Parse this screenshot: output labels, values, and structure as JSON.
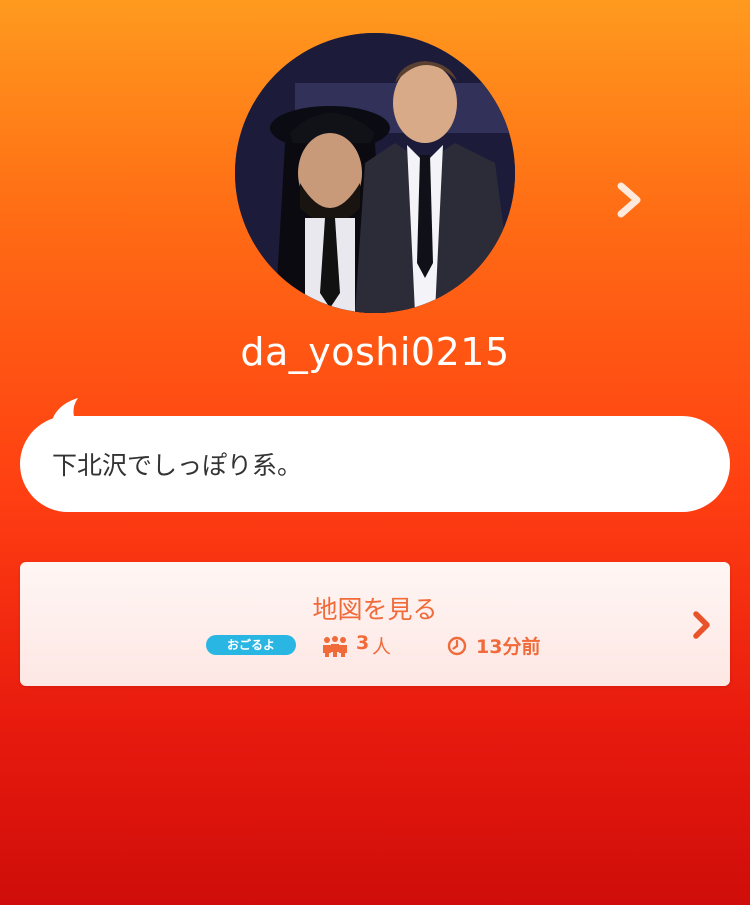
{
  "profile": {
    "username": "da_yoshi0215",
    "bio": "下北沢でしっぽり系。"
  },
  "map_card": {
    "title": "地図を見る",
    "badge": "おごるよ",
    "people_count": "3",
    "people_unit": "人",
    "time_ago": "13分前"
  },
  "colors": {
    "background_top": "#ff9a1e",
    "background_bottom": "#cf0d0a",
    "accent_text": "#f06a3a",
    "badge_bg": "#29b6e3"
  },
  "icons": {
    "next": "chevron-right-icon",
    "people": "people-icon",
    "time": "clock-icon",
    "card_arrow": "chevron-right-icon"
  }
}
